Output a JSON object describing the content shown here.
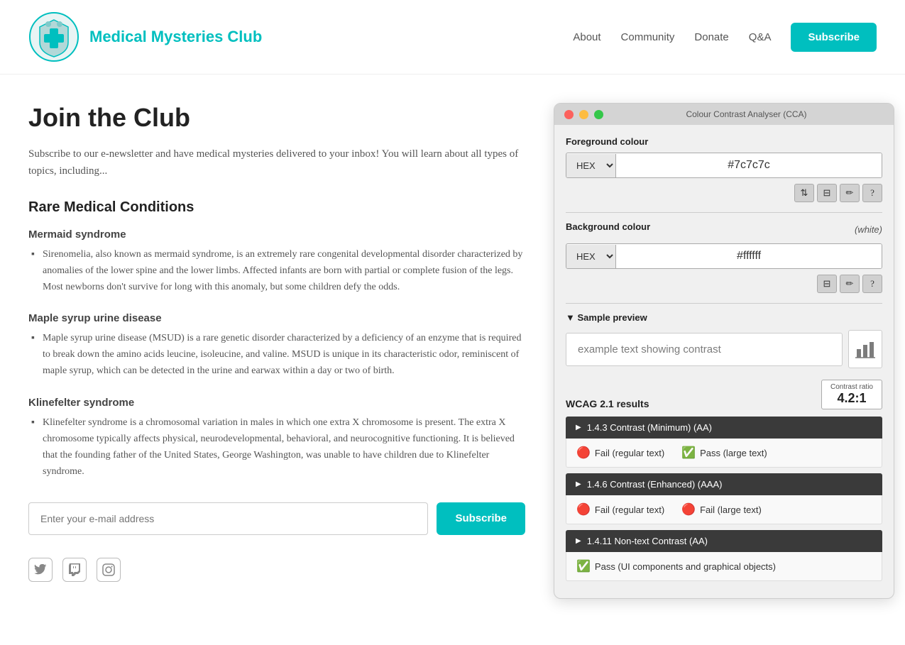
{
  "header": {
    "site_title": "Medical Mysteries Club",
    "nav": {
      "about": "About",
      "community": "Community",
      "donate": "Donate",
      "qa": "Q&A",
      "subscribe": "Subscribe"
    }
  },
  "main": {
    "page_title": "Join the Club",
    "intro_text": "Subscribe to our e-newsletter and have medical mysteries delivered to your inbox! You will learn about all types of topics, including...",
    "section_heading": "Rare Medical Conditions",
    "conditions": [
      {
        "name": "Mermaid syndrome",
        "description": "Sirenomelia, also known as mermaid syndrome, is an extremely rare congenital developmental disorder characterized by anomalies of the lower spine and the lower limbs. Affected infants are born with partial or complete fusion of the legs. Most newborns don't survive for long with this anomaly, but some children defy the odds."
      },
      {
        "name": "Maple syrup urine disease",
        "description": "Maple syrup urine disease (MSUD) is a rare genetic disorder characterized by a deficiency of an enzyme that is required to break down the amino acids leucine, isoleucine, and valine. MSUD is unique in its characteristic odor, reminiscent of maple syrup, which can be detected in the urine and earwax within a day or two of birth."
      },
      {
        "name": "Klinefelter syndrome",
        "description": "Klinefelter syndrome is a chromosomal variation in males in which one extra X chromosome is present. The extra X chromosome typically affects physical, neurodevelopmental, behavioral, and neurocognitive functioning. It is believed that the founding father of the United States, George Washington, was unable to have children due to Klinefelter syndrome."
      }
    ],
    "email_placeholder": "Enter your e-mail address",
    "subscribe_label": "Subscribe"
  },
  "cca": {
    "title": "Colour Contrast Analyser (CCA)",
    "foreground_label": "Foreground colour",
    "background_label": "Background colour",
    "background_note": "(white)",
    "fg_format": "HEX",
    "fg_value": "#7c7c7c",
    "bg_format": "HEX",
    "bg_value": "#ffffff",
    "sample_preview_label": "▼ Sample preview",
    "sample_text": "example text showing contrast",
    "wcag_label": "WCAG 2.1 results",
    "contrast_ratio_label": "Contrast ratio",
    "contrast_ratio_value": "4.2:1",
    "criteria": [
      {
        "id": "1.4.3",
        "label": "1.4.3 Contrast (Minimum) (AA)",
        "results": [
          {
            "pass": false,
            "text": "Fail (regular text)"
          },
          {
            "pass": true,
            "text": "Pass (large text)"
          }
        ]
      },
      {
        "id": "1.4.6",
        "label": "1.4.6 Contrast (Enhanced) (AAA)",
        "results": [
          {
            "pass": false,
            "text": "Fail (regular text)"
          },
          {
            "pass": false,
            "text": "Fail (large text)"
          }
        ]
      },
      {
        "id": "1.4.11",
        "label": "1.4.11 Non-text Contrast (AA)",
        "results": [
          {
            "pass": true,
            "text": "Pass (UI components and graphical objects)"
          }
        ]
      }
    ]
  }
}
